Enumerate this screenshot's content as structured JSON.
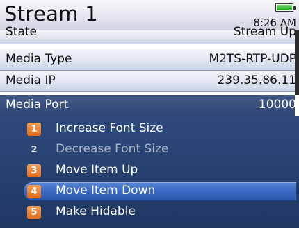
{
  "header": {
    "title": "Stream 1",
    "time": "8:26 AM",
    "battery_icon": "battery-full-icon"
  },
  "rows": [
    {
      "key": "State",
      "value": "Stream Up"
    },
    {
      "key": "Media Type",
      "value": "M2TS-RTP-UDP"
    },
    {
      "key": "Media IP",
      "value": "239.35.86.11"
    },
    {
      "key": "Media Port",
      "value": "10000"
    }
  ],
  "menu": {
    "items": [
      {
        "num": "1",
        "label": "Increase Font Size"
      },
      {
        "num": "2",
        "label": "Decrease Font Size"
      },
      {
        "num": "3",
        "label": "Move Item Up"
      },
      {
        "num": "4",
        "label": "Move Item Down"
      },
      {
        "num": "5",
        "label": "Make Hidable"
      }
    ]
  },
  "colors": {
    "menu_bg": "#26416f",
    "highlight": "#3a69c2",
    "number_badge": "#e06a17"
  }
}
